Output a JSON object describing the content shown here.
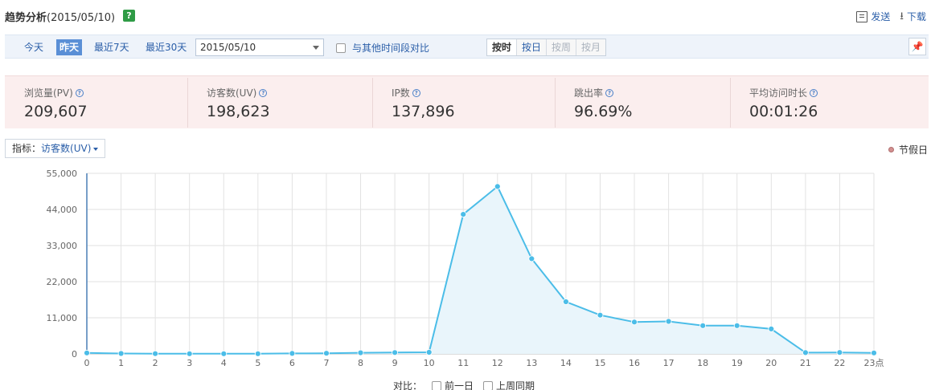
{
  "header": {
    "title": "趋势分析",
    "date": "(2015/05/10)",
    "help": "?",
    "actions": [
      {
        "label": "发送",
        "icon": "send-icon"
      },
      {
        "label": "下载",
        "icon": "download-icon"
      }
    ]
  },
  "toolbar": {
    "ranges": [
      "今天",
      "昨天",
      "最近7天",
      "最近30天"
    ],
    "active_range": "昨天",
    "date_value": "2015/05/10",
    "compare_label": "与其他时间段对比",
    "granularity": [
      {
        "label": "按时",
        "state": "active"
      },
      {
        "label": "按日",
        "state": "enabled"
      },
      {
        "label": "按周",
        "state": "disabled"
      },
      {
        "label": "按月",
        "state": "disabled"
      }
    ],
    "pin_icon": "pin-icon"
  },
  "metrics": [
    {
      "label": "浏览量(PV)",
      "value": "209,607"
    },
    {
      "label": "访客数(UV)",
      "value": "198,623"
    },
    {
      "label": "IP数",
      "value": "137,896"
    },
    {
      "label": "跳出率",
      "value": "96.69%"
    },
    {
      "label": "平均访问时长",
      "value": "00:01:26"
    }
  ],
  "indicator": {
    "label": "指标：",
    "value": "访客数(UV)"
  },
  "legend": {
    "holiday_label": "节假日",
    "holiday_color": "#d39090"
  },
  "chart_data": {
    "type": "area",
    "x": [
      0,
      1,
      2,
      3,
      4,
      5,
      6,
      7,
      8,
      9,
      10,
      11,
      12,
      13,
      14,
      15,
      16,
      17,
      18,
      19,
      20,
      21,
      22,
      23
    ],
    "x_tick_labels": [
      "0",
      "1",
      "2",
      "3",
      "4",
      "5",
      "6",
      "7",
      "8",
      "9",
      "10",
      "11",
      "12",
      "13",
      "14",
      "15",
      "16",
      "17",
      "18",
      "19",
      "20",
      "21",
      "22",
      "23点"
    ],
    "y_tick_labels": [
      "0",
      "11,000",
      "22,000",
      "33,000",
      "44,000",
      "55,000"
    ],
    "series": [
      {
        "values": [
          300,
          120,
          80,
          60,
          40,
          50,
          150,
          200,
          350,
          420,
          500,
          42500,
          51000,
          29000,
          15900,
          11800,
          9700,
          9900,
          8600,
          8600,
          7600,
          400,
          450,
          300
        ],
        "color": "#4bbde8",
        "fill": "#e9f5fb"
      }
    ],
    "ylim": [
      0,
      55000
    ],
    "grid": true
  },
  "compare_footer": {
    "label": "对比：",
    "options": [
      "前一日",
      "上周同期"
    ]
  }
}
